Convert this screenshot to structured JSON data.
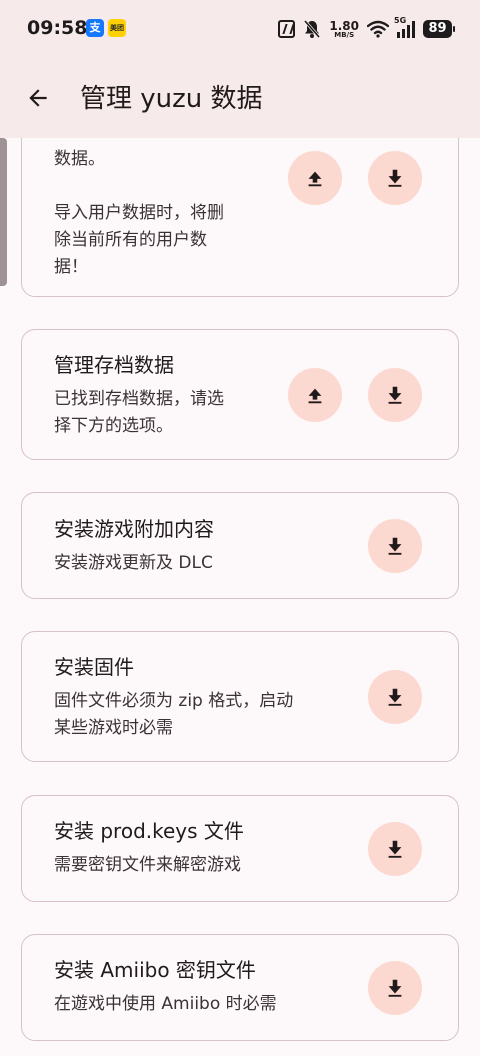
{
  "status_bar": {
    "time": "09:58",
    "app_badges": [
      {
        "icon": "alipay-icon",
        "text": "支"
      },
      {
        "icon": "meituan-icon",
        "text": "美团"
      }
    ],
    "net_speed": "1.80",
    "net_speed_unit": "MB/S",
    "network_type": "5G",
    "battery": "89"
  },
  "app_bar": {
    "back_icon": "arrow-back-icon",
    "title": "管理 yuzu 数据"
  },
  "cards": [
    {
      "title": "",
      "description": "数据。",
      "warning": "导入用户数据时，将删\n除当前所有的用户数\n据！",
      "buttons": [
        "export-icon",
        "import-icon"
      ]
    },
    {
      "title": "管理存档数据",
      "description": "已找到存档数据，请选\n择下方的选项。",
      "buttons": [
        "export-icon",
        "import-icon"
      ]
    },
    {
      "title": "安装游戏附加内容",
      "description": "安装游戏更新及 DLC",
      "buttons": [
        "install-icon"
      ]
    },
    {
      "title": "安装固件",
      "description": "固件文件必须为 zip 格式，启动\n某些游戏时必需",
      "buttons": [
        "install-icon"
      ]
    },
    {
      "title": "安装 prod.keys 文件",
      "description": "需要密钥文件来解密游戏",
      "buttons": [
        "install-icon"
      ]
    },
    {
      "title": "安装 Amiibo 密钥文件",
      "description": "在遊戏中使用 Amiibo 时必需",
      "buttons": [
        "install-icon"
      ]
    }
  ],
  "colors": {
    "accent_button_bg": "#fcd9d0",
    "top_bar_bg": "#f7eaea",
    "page_bg": "#fdf8fa",
    "card_border": "#d8c2c6"
  }
}
